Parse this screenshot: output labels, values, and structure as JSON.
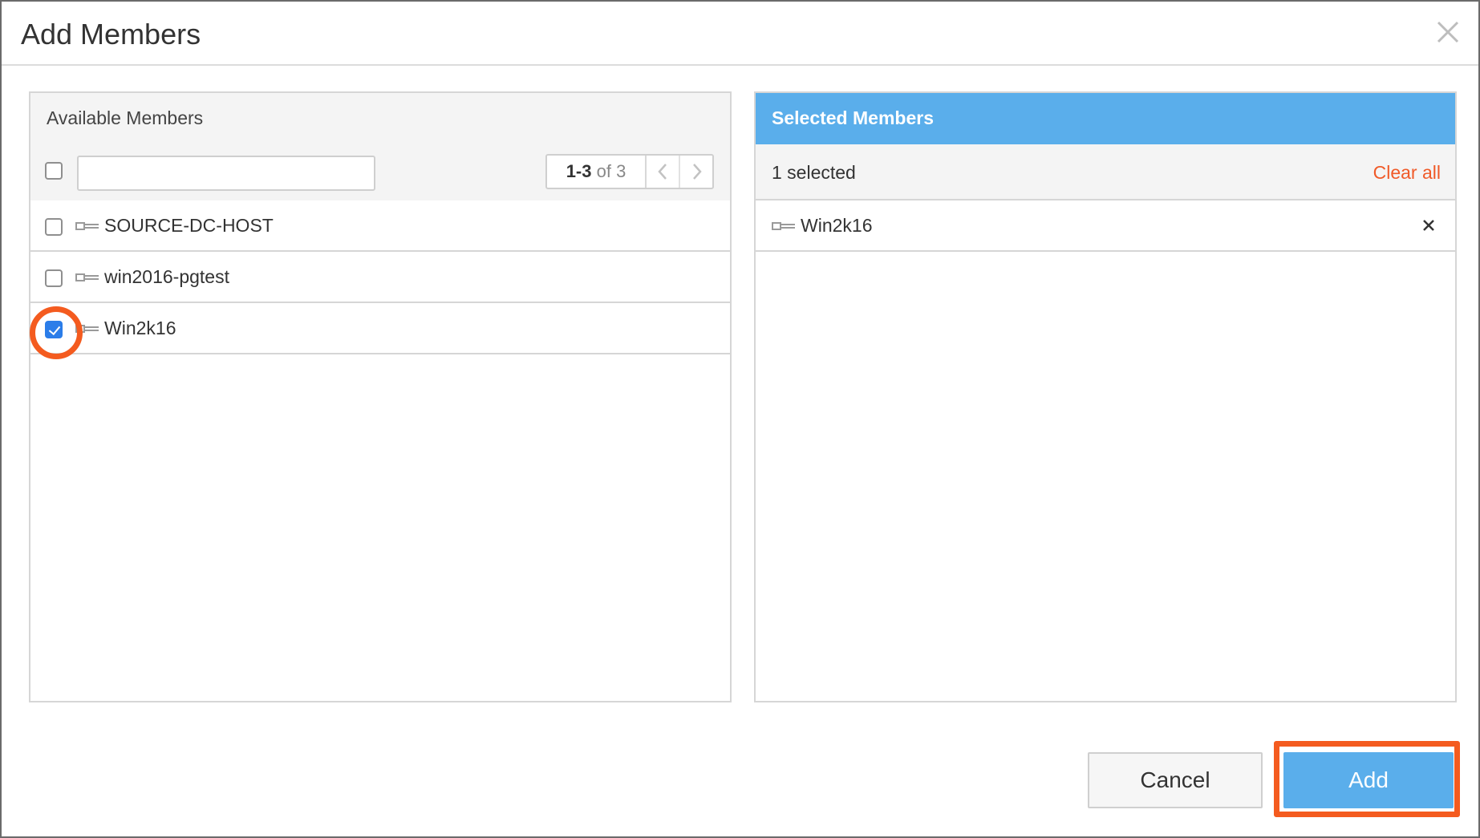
{
  "dialog": {
    "title": "Add Members",
    "close_icon": "close-icon"
  },
  "available": {
    "title": "Available Members",
    "search": {
      "value": "",
      "placeholder": ""
    },
    "pager": {
      "range": "1-3",
      "of_text": "of 3"
    },
    "items": [
      {
        "label": "SOURCE-DC-HOST",
        "checked": false,
        "icon": "host-icon"
      },
      {
        "label": "win2016-pgtest",
        "checked": false,
        "icon": "host-icon"
      },
      {
        "label": "Win2k16",
        "checked": true,
        "icon": "host-icon"
      }
    ]
  },
  "selected": {
    "title": "Selected Members",
    "count_text": "1 selected",
    "clear_all": "Clear all",
    "items": [
      {
        "label": "Win2k16",
        "icon": "host-icon"
      }
    ]
  },
  "footer": {
    "cancel_label": "Cancel",
    "add_label": "Add"
  },
  "colors": {
    "accent": "#5aaeeb",
    "checkbox_checked": "#2b7de9",
    "clear_all": "#f05a28",
    "highlight": "#f45b1f"
  }
}
